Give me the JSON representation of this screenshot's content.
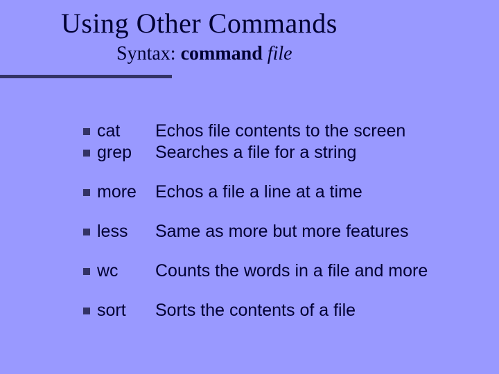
{
  "title": "Using Other Commands",
  "subtitle": {
    "label": "Syntax: ",
    "cmd": "command ",
    "arg": "file"
  },
  "items": [
    {
      "cmd": "cat",
      "desc": "Echos file contents to the screen"
    },
    {
      "cmd": "grep",
      "desc": "Searches a file for a string"
    },
    {
      "cmd": "more",
      "desc": "Echos a file a line at a time"
    },
    {
      "cmd": "less",
      "desc": "Same as more but more features"
    },
    {
      "cmd": "wc",
      "desc": "Counts the words in a file and more"
    },
    {
      "cmd": "sort",
      "desc": "Sorts the contents of a file"
    }
  ]
}
